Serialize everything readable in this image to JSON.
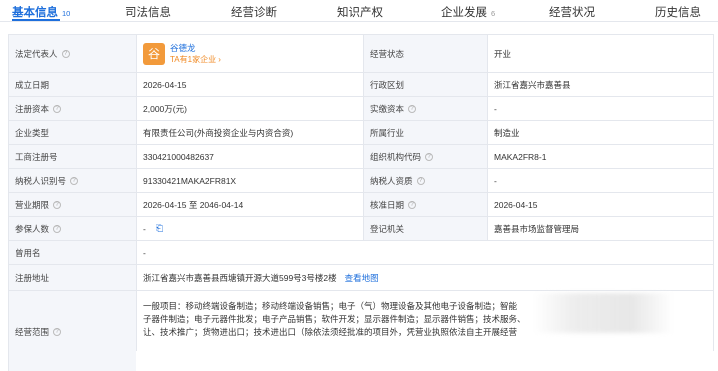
{
  "tabs": [
    {
      "label": "基本信息",
      "count": "10"
    },
    {
      "label": "司法信息",
      "count": ""
    },
    {
      "label": "经营诊断",
      "count": ""
    },
    {
      "label": "知识产权",
      "count": ""
    },
    {
      "label": "企业发展",
      "count": "6"
    },
    {
      "label": "经营状况",
      "count": ""
    },
    {
      "label": "历史信息",
      "count": ""
    }
  ],
  "info": {
    "legal_rep_label": "法定代表人",
    "legal_rep_avatar": "谷",
    "legal_rep_name": "谷德龙",
    "legal_rep_sub": "TA有1家企业 ›",
    "status_label": "经营状态",
    "status_value": "开业",
    "est_date_label": "成立日期",
    "est_date_value": "2026-04-15",
    "region_label": "行政区划",
    "region_value": "浙江省嘉兴市嘉善县",
    "reg_capital_label": "注册资本",
    "reg_capital_value": "2,000万(元)",
    "paid_capital_label": "实缴资本",
    "paid_capital_value": "-",
    "type_label": "企业类型",
    "type_value": "有限责任公司(外商投资企业与内资合资)",
    "industry_label": "所属行业",
    "industry_value": "制造业",
    "biz_reg_no_label": "工商注册号",
    "biz_reg_no_value": "330421000482637",
    "org_code_label": "组织机构代码",
    "org_code_value": "MAKA2FR8-1",
    "tax_id_label": "纳税人识别号",
    "tax_id_value": "91330421MAKA2FR81X",
    "tax_qual_label": "纳税人资质",
    "tax_qual_value": "-",
    "term_label": "营业期限",
    "term_value": "2026-04-15 至 2046-04-14",
    "approve_date_label": "核准日期",
    "approve_date_value": "2026-04-15",
    "insured_label": "参保人数",
    "insured_value": "-",
    "authority_label": "登记机关",
    "authority_value": "嘉善县市场监督管理局",
    "former_name_label": "曾用名",
    "former_name_value": "-",
    "address_label": "注册地址",
    "address_value": "浙江省嘉兴市嘉善县西塘镇开源大道599号3号楼2楼",
    "address_map_link": "查看地图",
    "scope_label": "经营范围",
    "scope_lines": [
      "一般项目：移动终端设备制造；移动终端设备销售；电子（气）物理设备及其他电子设备制造；智能",
      "子器件制造；电子元器件批发；电子产品销售；软件开发；显示器件制造；显示器件销售；技术服务、",
      "让、技术推广；货物进出口；技术进出口（除依法须经批准的项目外，凭营业执照依法自主开展经营"
    ]
  }
}
